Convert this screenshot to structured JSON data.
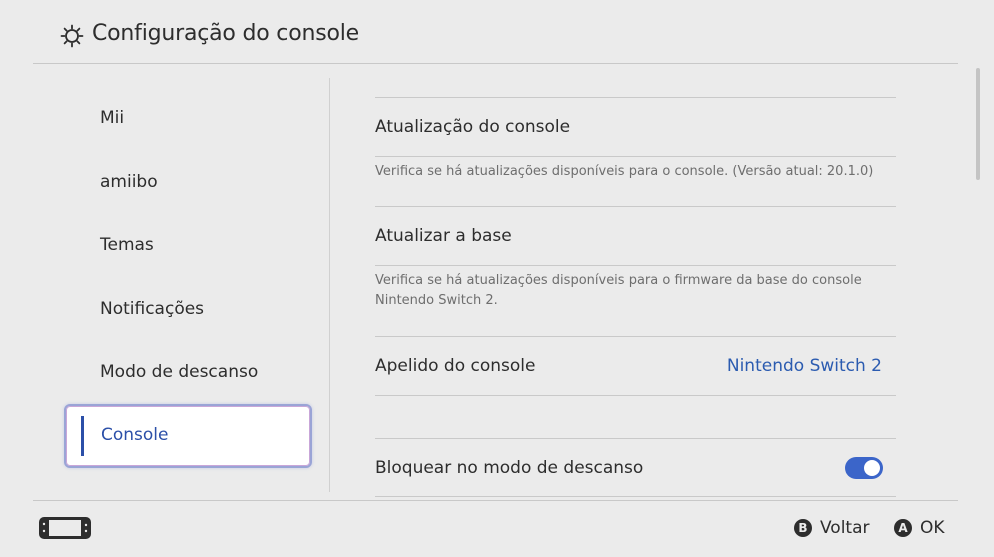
{
  "header": {
    "title": "Configuração do console",
    "icon": "gear-icon"
  },
  "sidebar": {
    "items": [
      {
        "label": "Mii"
      },
      {
        "label": "amiibo"
      },
      {
        "label": "Temas"
      },
      {
        "label": "Notificações"
      },
      {
        "label": "Modo de descanso"
      },
      {
        "label": "Console",
        "selected": true
      }
    ]
  },
  "content": {
    "update_console": {
      "title": "Atualização do console",
      "description": "Verifica se há atualizações disponíveis para o console. (Versão atual: 20.1.0)"
    },
    "update_dock": {
      "title": "Atualizar a base",
      "description": "Verifica se há atualizações disponíveis para o firmware da base do console Nintendo Switch 2."
    },
    "nickname": {
      "title": "Apelido do console",
      "value": "Nintendo Switch 2"
    },
    "sleep_lock": {
      "title": "Bloquear no modo de descanso",
      "enabled": true
    }
  },
  "footer": {
    "console_icon": "console-icon",
    "back": {
      "glyph": "B",
      "label": "Voltar"
    },
    "ok": {
      "glyph": "A",
      "label": "OK"
    }
  },
  "colors": {
    "accent": "#2b4fa8",
    "link": "#2b5bb0",
    "toggle": "#3b65c9",
    "background": "#ebebeb"
  }
}
